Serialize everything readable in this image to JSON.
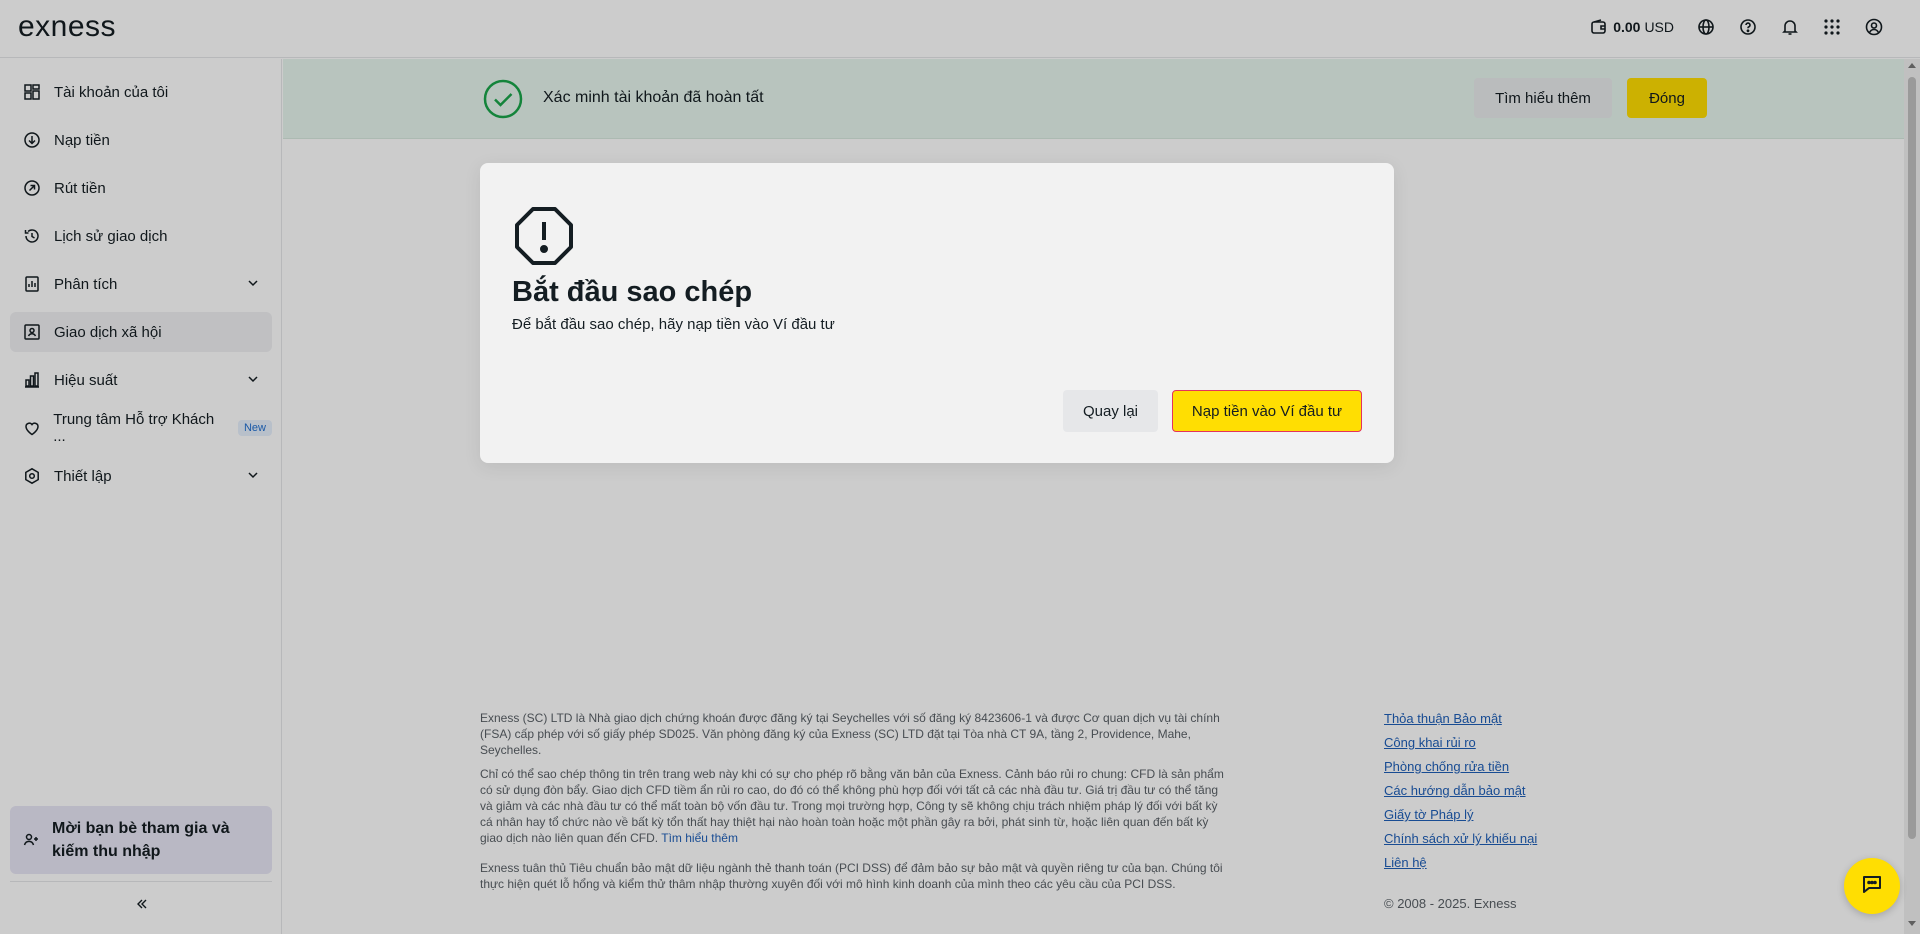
{
  "header": {
    "logo": "exness",
    "balance_amount": "0.00",
    "balance_currency": "USD"
  },
  "sidebar": {
    "items": [
      {
        "label": "Tài khoản của tôi",
        "icon": "grid-icon"
      },
      {
        "label": "Nạp tiền",
        "icon": "arrow-down-circle-icon"
      },
      {
        "label": "Rút tiền",
        "icon": "arrow-up-right-circle-icon"
      },
      {
        "label": "Lịch sử giao dịch",
        "icon": "history-icon"
      },
      {
        "label": "Phân tích",
        "icon": "analytics-icon"
      },
      {
        "label": "Giao dịch xã hội",
        "icon": "social-trading-icon"
      },
      {
        "label": "Hiệu suất",
        "icon": "bar-chart-icon"
      },
      {
        "label": "Trung tâm Hỗ trợ Khách ...",
        "icon": "heart-icon",
        "badge": "New"
      },
      {
        "label": "Thiết lập",
        "icon": "settings-icon"
      }
    ],
    "invite_text": "Mời bạn bè tham gia và kiếm thu nhập"
  },
  "banner": {
    "text": "Xác minh tài khoản đã hoàn tất",
    "learn_more": "Tìm hiểu thêm",
    "close": "Đóng"
  },
  "modal": {
    "title": "Bắt đầu sao chép",
    "subtitle": "Để bắt đầu sao chép, hãy nạp tiền vào Ví đầu tư",
    "back": "Quay lại",
    "deposit": "Nạp tiền vào Ví đầu tư"
  },
  "footer": {
    "para1": "Exness (SC) LTD là Nhà giao dịch chứng khoán được đăng ký tại Seychelles với số đăng ký 8423606-1 và được Cơ quan dịch vụ tài chính (FSA) cấp phép với số giấy phép SD025. Văn phòng đăng ký của Exness (SC) LTD đặt tại Tòa nhà CT 9A, tầng 2, Providence, Mahe, Seychelles.",
    "para2": "Chỉ có thể sao chép thông tin trên trang web này khi có sự cho phép rõ bằng văn bản của Exness. Cảnh báo rủi ro chung: CFD là sản phẩm có sử dụng đòn bẩy. Giao dịch CFD tiềm ẩn rủi ro cao, do đó có thể không phù hợp đối với tất cả các nhà đầu tư. Giá trị đầu tư có thể tăng và giảm và các nhà đầu tư có thể mất toàn bộ vốn đầu tư. Trong mọi trường hợp, Công ty sẽ không chịu trách nhiệm pháp lý đối với bất kỳ cá nhân hay tổ chức nào về bất kỳ tổn thất hay thiệt hại nào hoàn toàn hoặc một phần gây ra bởi, phát sinh từ, hoặc liên quan đến bất kỳ giao dịch nào liên quan đến CFD.",
    "para2_link": "Tìm hiểu thêm",
    "para3": "Exness tuân thủ Tiêu chuẩn bảo mật dữ liệu ngành thẻ thanh toán (PCI DSS) để đảm bảo sự bảo mật và quyền riêng tư của bạn. Chúng tôi thực hiện quét lỗ hổng và kiểm thử thâm nhập thường xuyên đối với mô hình kinh doanh của mình theo các yêu cầu của PCI DSS.",
    "links": [
      "Thỏa thuận Bảo mật",
      "Công khai rủi ro",
      "Phòng chống rửa tiền",
      "Các hướng dẫn bảo mật",
      "Giấy tờ Pháp lý",
      "Chính sách xử lý khiếu nại",
      "Liên hệ"
    ],
    "copyright": "© 2008 - 2025. Exness"
  }
}
